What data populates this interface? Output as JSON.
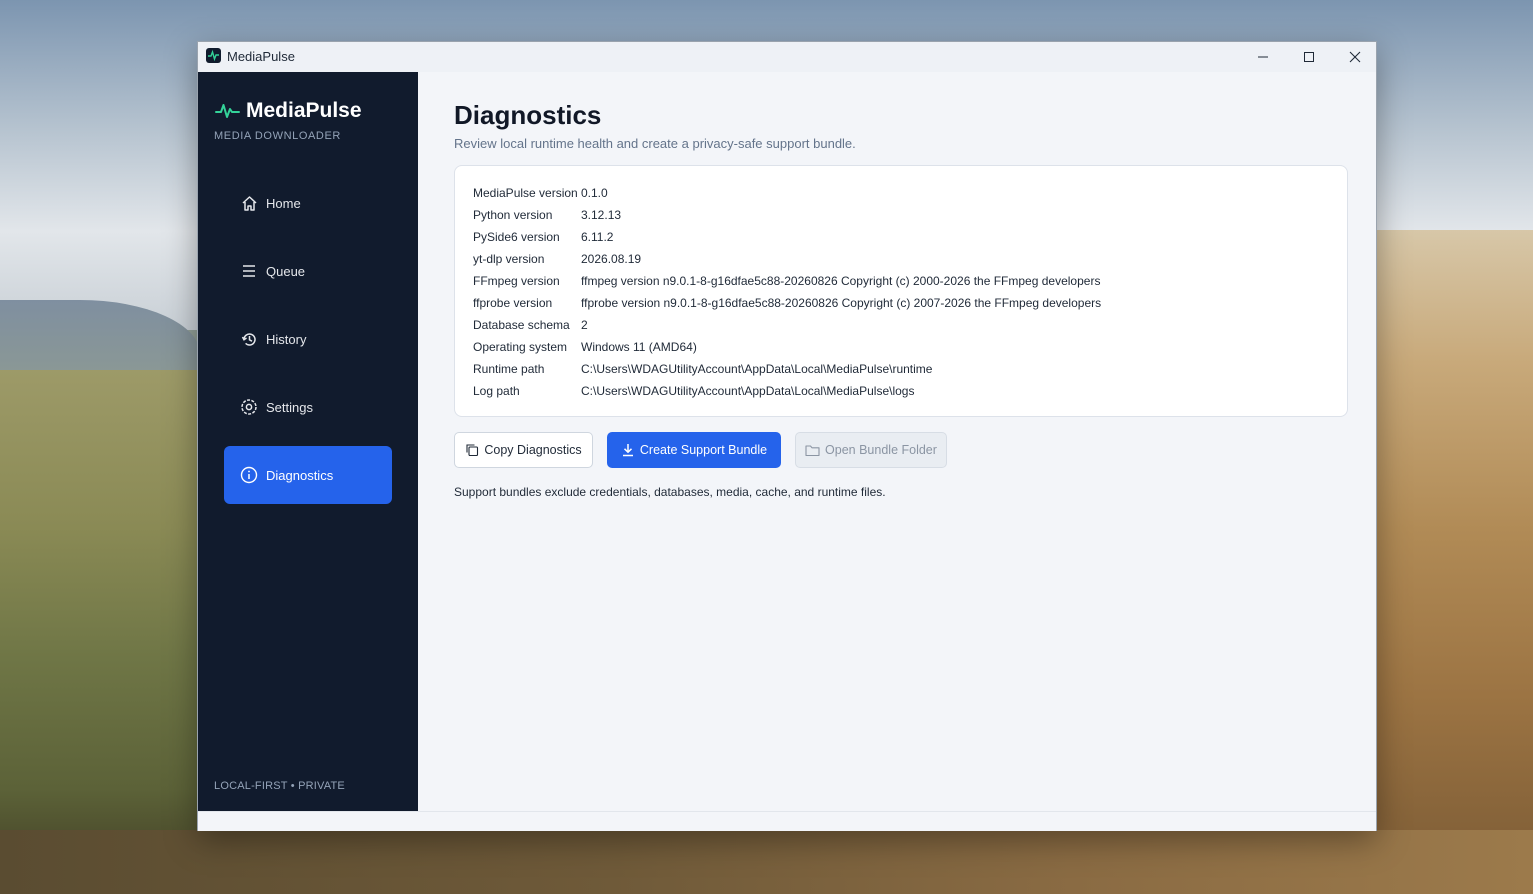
{
  "window": {
    "title": "MediaPulse"
  },
  "sidebar": {
    "brand_name": "MediaPulse",
    "brand_subtitle": "MEDIA DOWNLOADER",
    "items": [
      {
        "label": "Home",
        "icon": "home-icon"
      },
      {
        "label": "Queue",
        "icon": "list-icon"
      },
      {
        "label": "History",
        "icon": "history-icon"
      },
      {
        "label": "Settings",
        "icon": "gear-icon"
      },
      {
        "label": "Diagnostics",
        "icon": "info-icon",
        "active": true
      }
    ],
    "footer": "LOCAL-FIRST • PRIVATE"
  },
  "main": {
    "title": "Diagnostics",
    "subtitle": "Review local runtime health and create a privacy-safe support bundle.",
    "info": [
      {
        "key": "MediaPulse version",
        "value": "0.1.0"
      },
      {
        "key": "Python version",
        "value": "3.12.13"
      },
      {
        "key": "PySide6 version",
        "value": "6.11.2"
      },
      {
        "key": "yt-dlp version",
        "value": "2026.08.19"
      },
      {
        "key": "FFmpeg version",
        "value": "ffmpeg version n9.0.1-8-g16dfae5c88-20260826 Copyright (c) 2000-2026 the FFmpeg developers"
      },
      {
        "key": "ffprobe version",
        "value": "ffprobe version n9.0.1-8-g16dfae5c88-20260826 Copyright (c) 2007-2026 the FFmpeg developers"
      },
      {
        "key": "Database schema",
        "value": "2"
      },
      {
        "key": "Operating system",
        "value": "Windows 11 (AMD64)"
      },
      {
        "key": "Runtime path",
        "value": "C:\\Users\\WDAGUtilityAccount\\AppData\\Local\\MediaPulse\\runtime"
      },
      {
        "key": "Log path",
        "value": "C:\\Users\\WDAGUtilityAccount\\AppData\\Local\\MediaPulse\\logs"
      }
    ],
    "buttons": {
      "copy": "Copy Diagnostics",
      "create": "Create Support Bundle",
      "open": "Open Bundle Folder"
    },
    "note": "Support bundles exclude credentials, databases, media, cache, and runtime files."
  },
  "colors": {
    "accent": "#2563eb",
    "sidebar_bg": "#111b2d",
    "brand_pulse": "#34d399"
  }
}
